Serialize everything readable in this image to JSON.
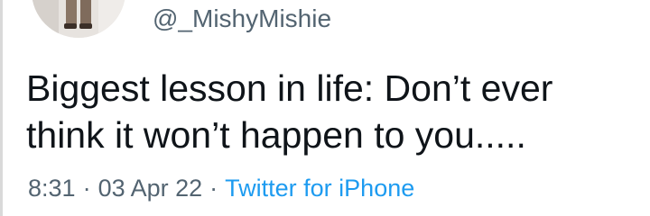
{
  "tweet": {
    "handle": "@_MishyMishie",
    "text_lines": [
      "Biggest lesson in life: Don’t ever",
      "think it won’t happen to you....."
    ],
    "time": "8:31",
    "date": "03 Apr 22",
    "separator": "·",
    "source": "Twitter for iPhone"
  },
  "colors": {
    "text": "#0f1419",
    "secondary": "#536471",
    "link": "#1d9bf0"
  },
  "icons": {
    "avatar": "user-avatar-photo"
  }
}
